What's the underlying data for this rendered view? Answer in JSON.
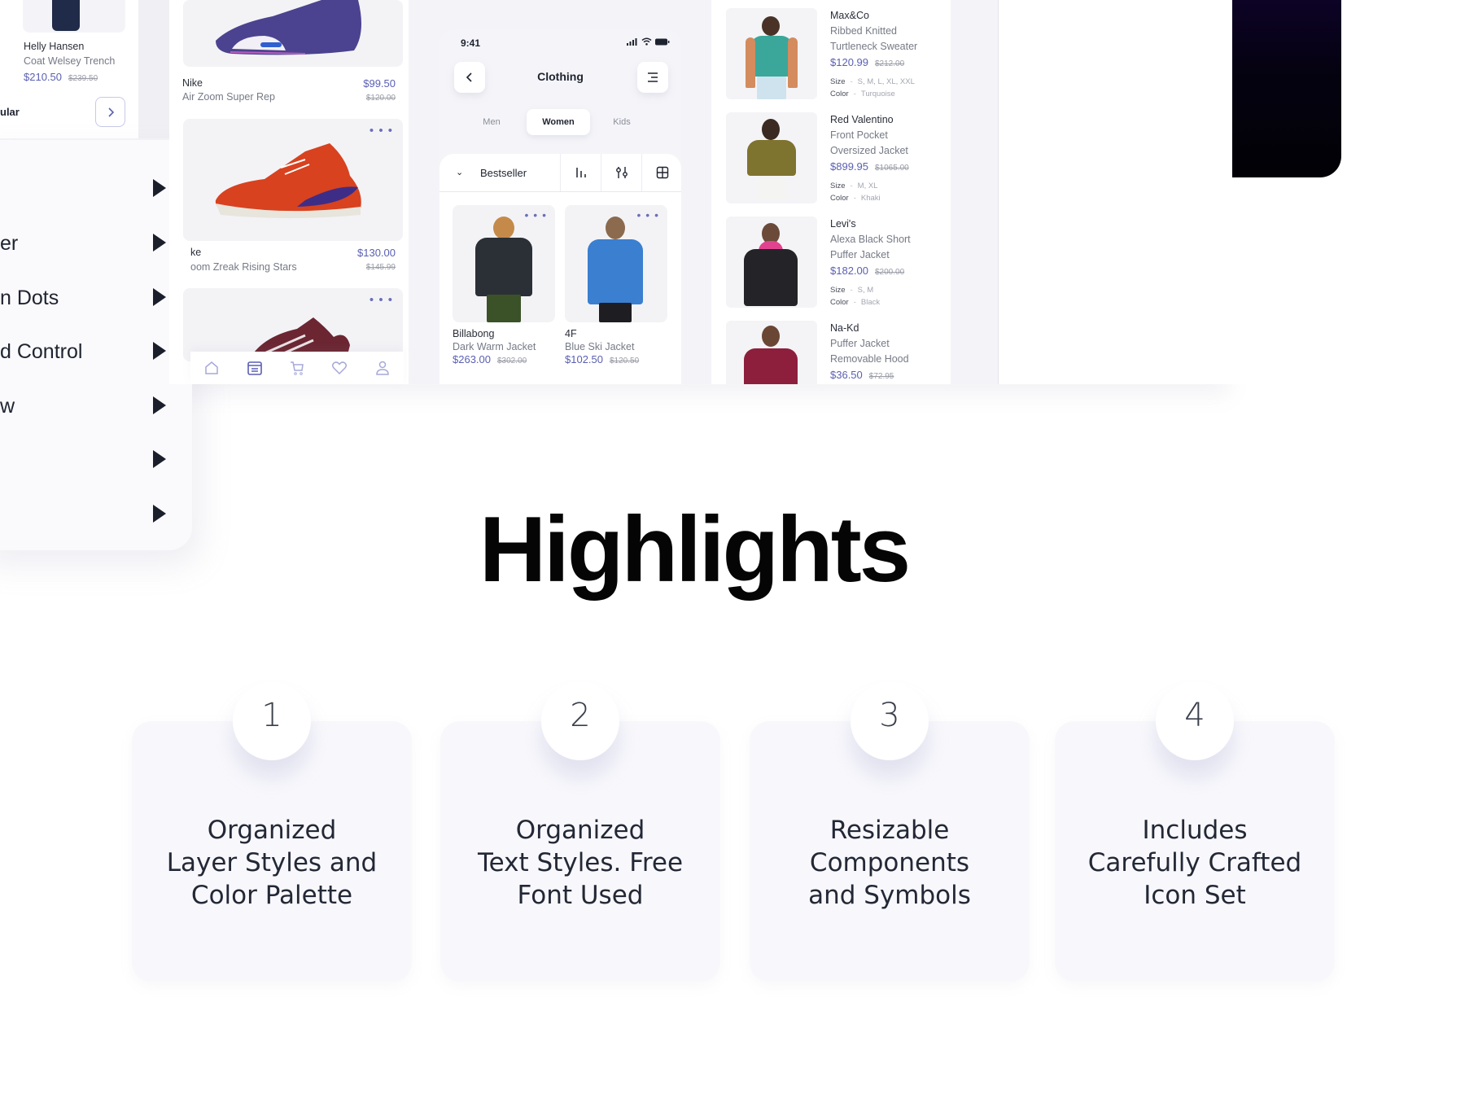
{
  "left_card": {
    "brand": "Helly Hansen",
    "name": "Coat Welsey Trench",
    "price": "$210.50",
    "old_price": "$239.50",
    "section_label": "ular",
    "next_icon": "chevron-right-icon"
  },
  "menu": {
    "items": [
      {
        "label": "",
        "icon": "triangle-right-icon"
      },
      {
        "label": "er",
        "icon": "triangle-right-icon"
      },
      {
        "label": "n Dots",
        "icon": "triangle-right-icon"
      },
      {
        "label": "d Control",
        "icon": "triangle-right-icon"
      },
      {
        "label": "w",
        "icon": "triangle-right-icon"
      },
      {
        "label": "",
        "icon": "triangle-right-icon"
      },
      {
        "label": "",
        "icon": "triangle-right-icon"
      }
    ]
  },
  "shoes": {
    "items": [
      {
        "brand": "Nike",
        "name": "Air Zoom Super Rep",
        "price": "$99.50",
        "old_price": "$120.00"
      },
      {
        "brand": "ke",
        "name": "oom Zreak Rising Stars",
        "price": "$130.00",
        "old_price": "$145.99"
      }
    ],
    "more_label": "• • •",
    "bottom_nav": [
      "home-icon",
      "catalog-icon",
      "cart-icon",
      "heart-icon",
      "profile-icon"
    ]
  },
  "phone": {
    "time": "9:41",
    "title": "Clothing",
    "back_icon": "chevron-left-icon",
    "menu_icon": "menu-icon",
    "tabs": [
      {
        "label": "Men",
        "active": false
      },
      {
        "label": "Women",
        "active": true
      },
      {
        "label": "Kids",
        "active": false
      }
    ],
    "sort": {
      "label": "Bestseller",
      "chevron": "⌄",
      "tools": [
        "bar-chart-icon",
        "filter-sliders-icon",
        "grid-view-icon"
      ]
    },
    "products": [
      {
        "brand": "Billabong",
        "name": "Dark Warm Jacket",
        "price": "$263.00",
        "old_price": "$302.00"
      },
      {
        "brand": "4F",
        "name": "Blue Ski Jacket",
        "price": "$102.50",
        "old_price": "$120.50"
      }
    ],
    "more_label": "• • •"
  },
  "list": {
    "size_label": "Size",
    "color_label": "Color",
    "sep": "-",
    "items": [
      {
        "brand": "Max&Co",
        "name1": "Ribbed Knitted",
        "name2": "Turtleneck Sweater",
        "price": "$120.99",
        "old_price": "$212.00",
        "size": "S, M, L, XL, XXL",
        "color": "Turquoise"
      },
      {
        "brand": "Red Valentino",
        "name1": "Front Pocket",
        "name2": "Oversized Jacket",
        "price": "$899.95",
        "old_price": "$1065.00",
        "size": "M, XL",
        "color": "Khaki"
      },
      {
        "brand": "Levi's",
        "name1": "Alexa Black Short",
        "name2": "Puffer Jacket",
        "price": "$182.00",
        "old_price": "$200.00",
        "size": "S, M",
        "color": "Black"
      },
      {
        "brand": "Na-Kd",
        "name1": "Puffer Jacket",
        "name2": "Removable Hood",
        "price": "$36.50",
        "old_price": "$72.95"
      }
    ]
  },
  "highlights": {
    "title": "Highlights",
    "cards": [
      {
        "number": "1",
        "text": "Organized\nLayer Styles and\nColor Palette"
      },
      {
        "number": "2",
        "text": "Organized\nText Styles. Free\nFont Used"
      },
      {
        "number": "3",
        "text": "Resizable\nComponents\nand Symbols"
      },
      {
        "number": "4",
        "text": "Includes\nCarefully Crafted\nIcon Set"
      }
    ]
  },
  "colors": {
    "accent": "#5a5fb3",
    "text_primary": "#1e2330",
    "text_secondary": "#767a86",
    "panel_bg": "#f4f4f8",
    "card_bg": "#f8f8fc",
    "dark_block": "#050211"
  }
}
